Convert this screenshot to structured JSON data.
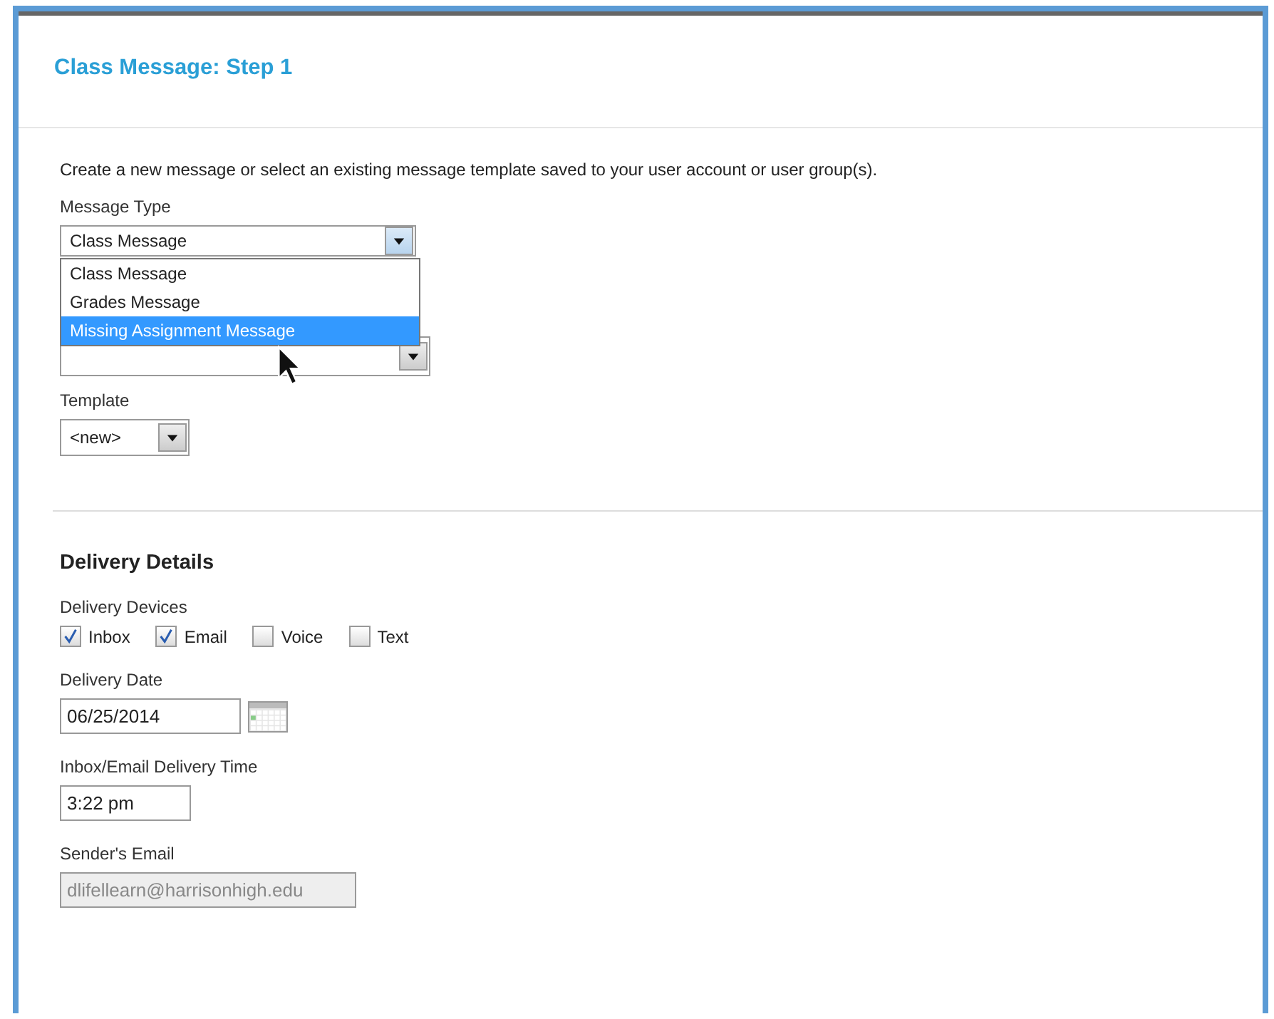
{
  "page": {
    "title": "Class Message: Step 1",
    "intro": "Create a new message or select an existing message template saved to your user account or user group(s)."
  },
  "message_type": {
    "label": "Message Type",
    "value": "Class Message",
    "expanded": true,
    "options": [
      {
        "label": "Class Message",
        "highlighted": false
      },
      {
        "label": "Grades Message",
        "highlighted": false
      },
      {
        "label": "Missing Assignment Message",
        "highlighted": true
      }
    ]
  },
  "template": {
    "label": "Template",
    "value": "<new>"
  },
  "delivery": {
    "heading": "Delivery Details",
    "devices_label": "Delivery Devices",
    "devices": [
      {
        "label": "Inbox",
        "checked": true
      },
      {
        "label": "Email",
        "checked": true
      },
      {
        "label": "Voice",
        "checked": false
      },
      {
        "label": "Text",
        "checked": false
      }
    ],
    "date_label": "Delivery Date",
    "date": "06/25/2014",
    "time_label": "Inbox/Email Delivery Time",
    "time": "3:22 pm",
    "sender_label": "Sender's Email",
    "sender": "dlifellearn@harrisonhigh.edu",
    "sender_disabled": true
  }
}
